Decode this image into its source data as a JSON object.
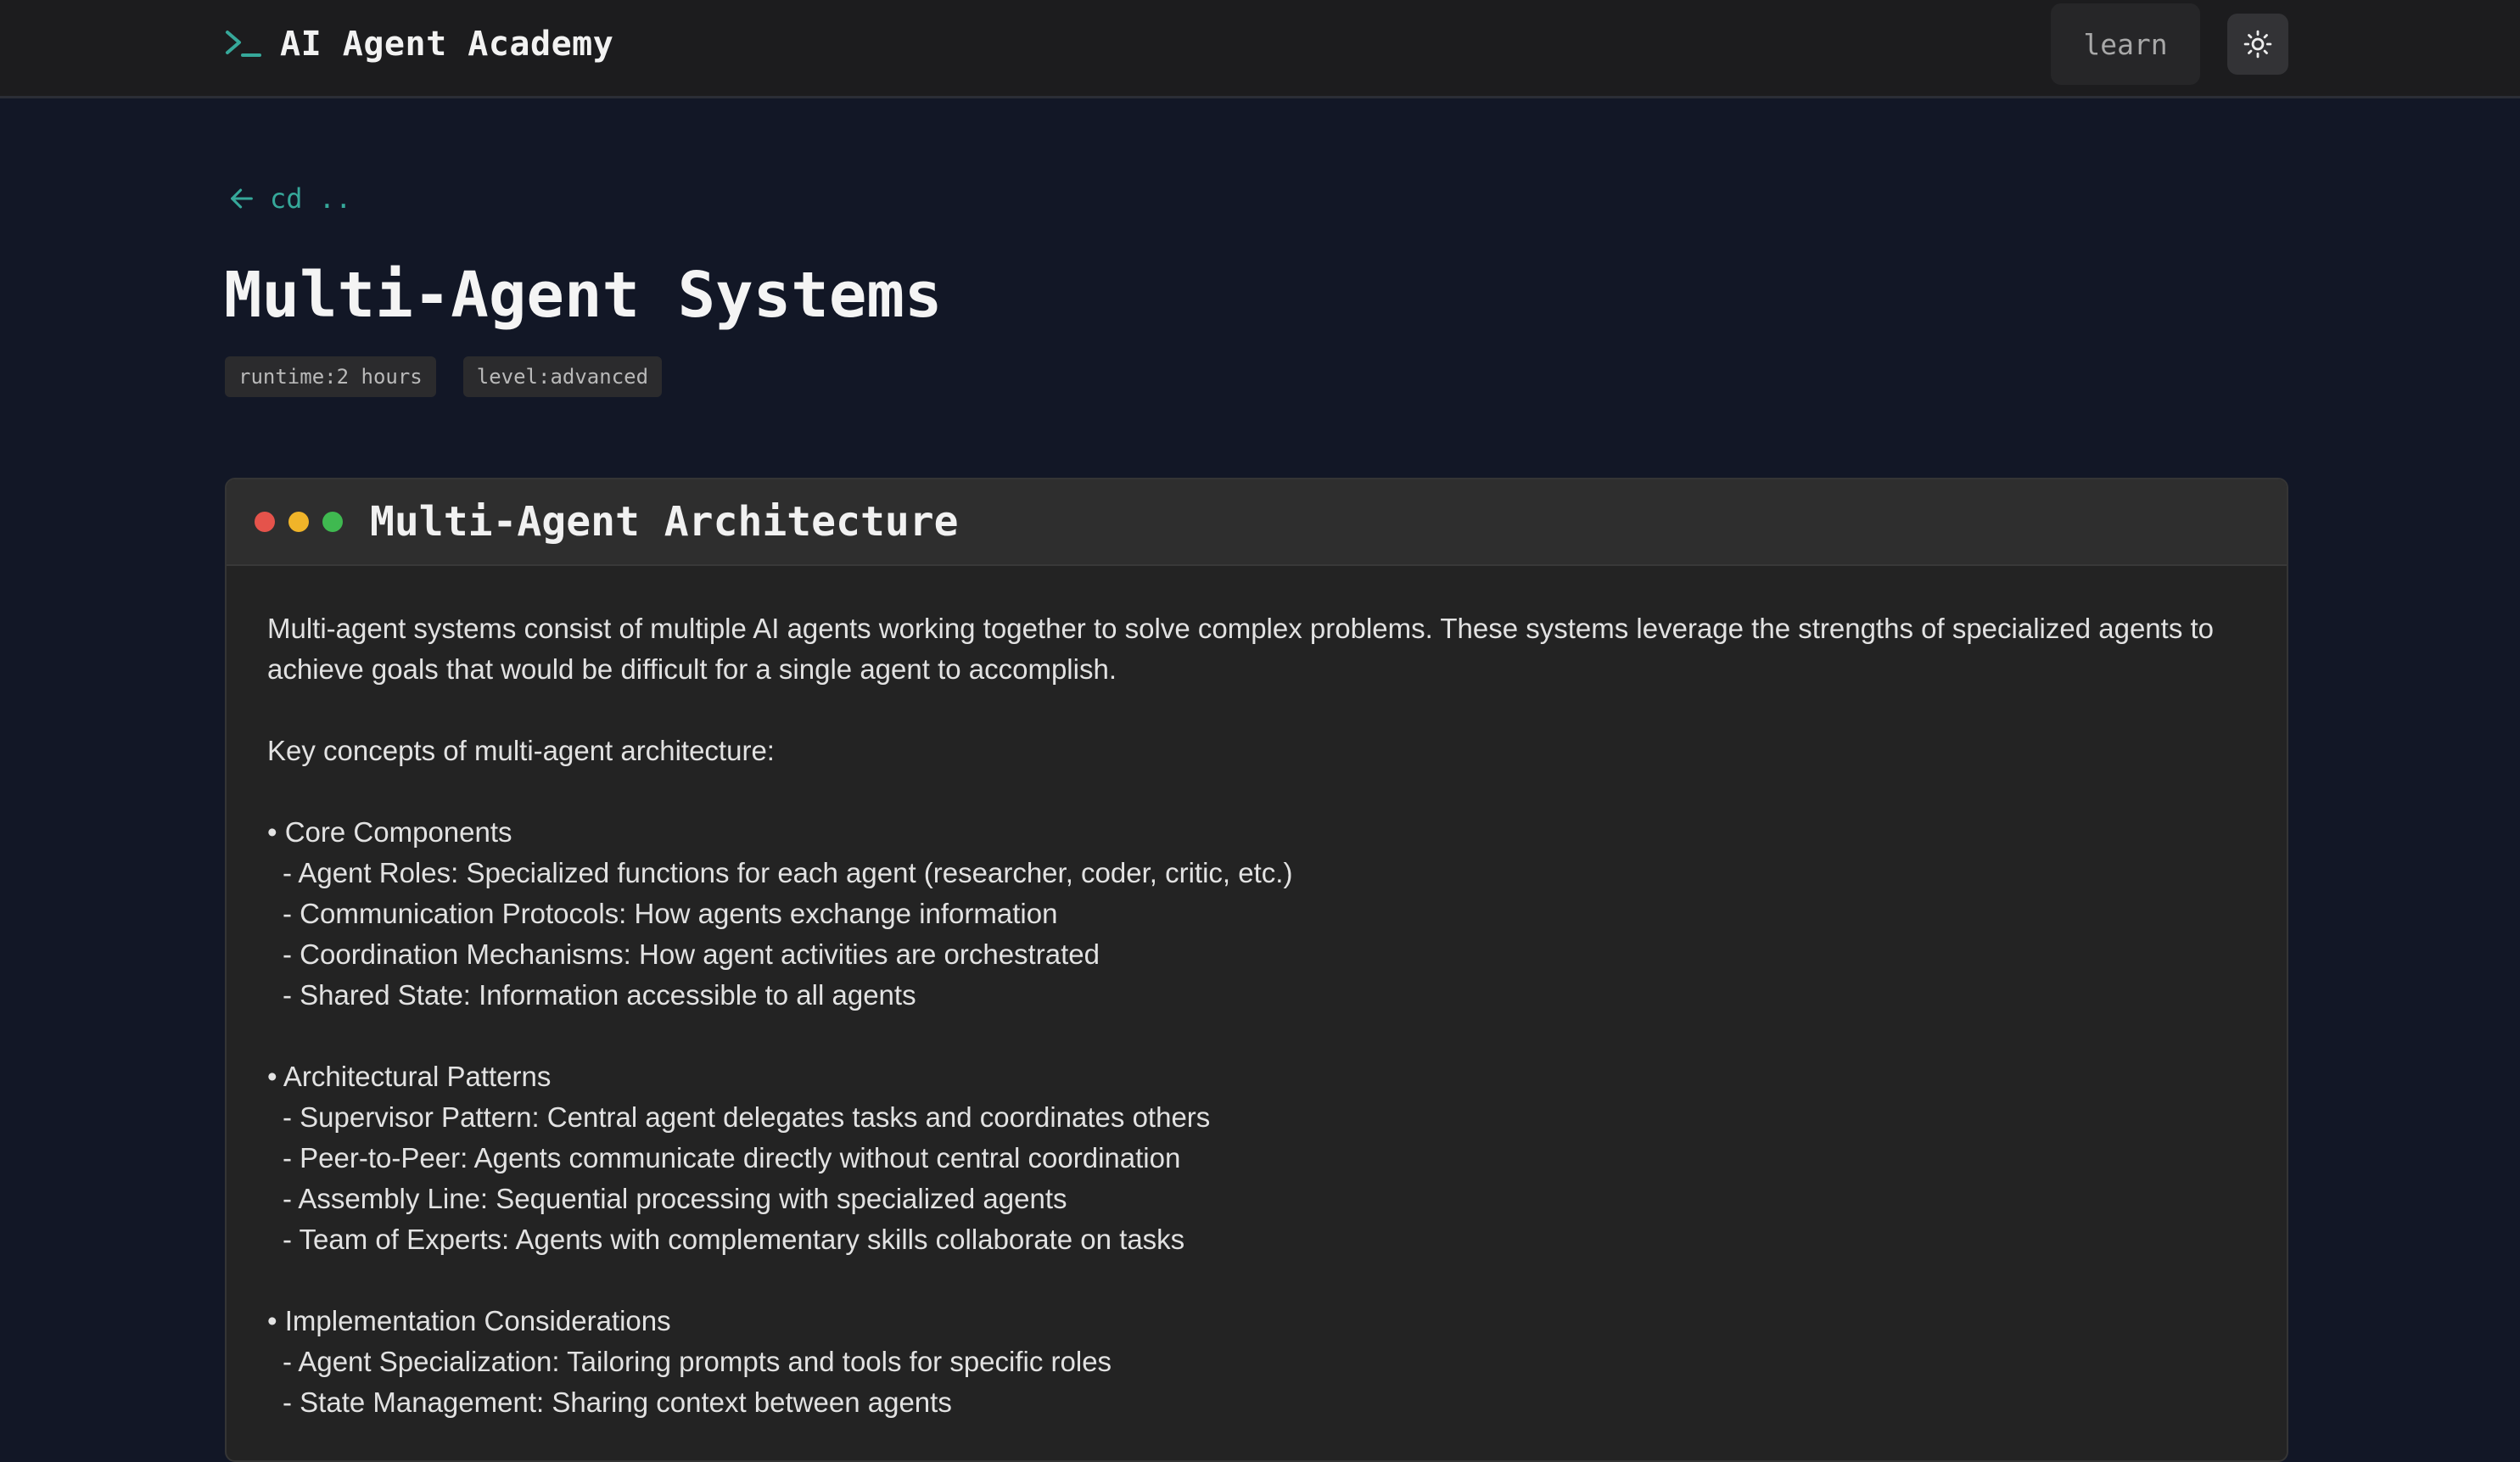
{
  "header": {
    "brand_prompt_icon": "terminal-prompt-icon",
    "brand_title": "AI Agent Academy",
    "nav_learn": "learn",
    "theme_toggle_icon": "sun-icon"
  },
  "back": {
    "icon": "arrow-left-icon",
    "label": "cd .."
  },
  "page": {
    "title": "Multi-Agent Systems",
    "tags": [
      "runtime:2 hours",
      "level:advanced"
    ]
  },
  "panel": {
    "title": "Multi-Agent Architecture",
    "intro": "Multi-agent systems consist of multiple AI agents working together to solve complex problems. These systems leverage the strengths of specialized agents to achieve goals that would be difficult for a single agent to accomplish.",
    "key_concepts": "Key concepts of multi-agent architecture:",
    "sections": [
      {
        "heading": "• Core Components",
        "items": [
          "- Agent Roles: Specialized functions for each agent (researcher, coder, critic, etc.)",
          "- Communication Protocols: How agents exchange information",
          "- Coordination Mechanisms: How agent activities are orchestrated",
          "- Shared State: Information accessible to all agents"
        ]
      },
      {
        "heading": "• Architectural Patterns",
        "items": [
          "- Supervisor Pattern: Central agent delegates tasks and coordinates others",
          "- Peer-to-Peer: Agents communicate directly without central coordination",
          "- Assembly Line: Sequential processing with specialized agents",
          "- Team of Experts: Agents with complementary skills collaborate on tasks"
        ]
      },
      {
        "heading": "• Implementation Considerations",
        "items": [
          "- Agent Specialization: Tailoring prompts and tools for specific roles",
          "- State Management: Sharing context between agents"
        ]
      }
    ]
  },
  "colors": {
    "page_bg": "#121726",
    "topbar_bg": "#1c1c1e",
    "accent_teal": "#36a89a",
    "panel_bg": "#232323",
    "dot_red": "#e5534b",
    "dot_yellow": "#f0b429",
    "dot_green": "#3fb950"
  }
}
